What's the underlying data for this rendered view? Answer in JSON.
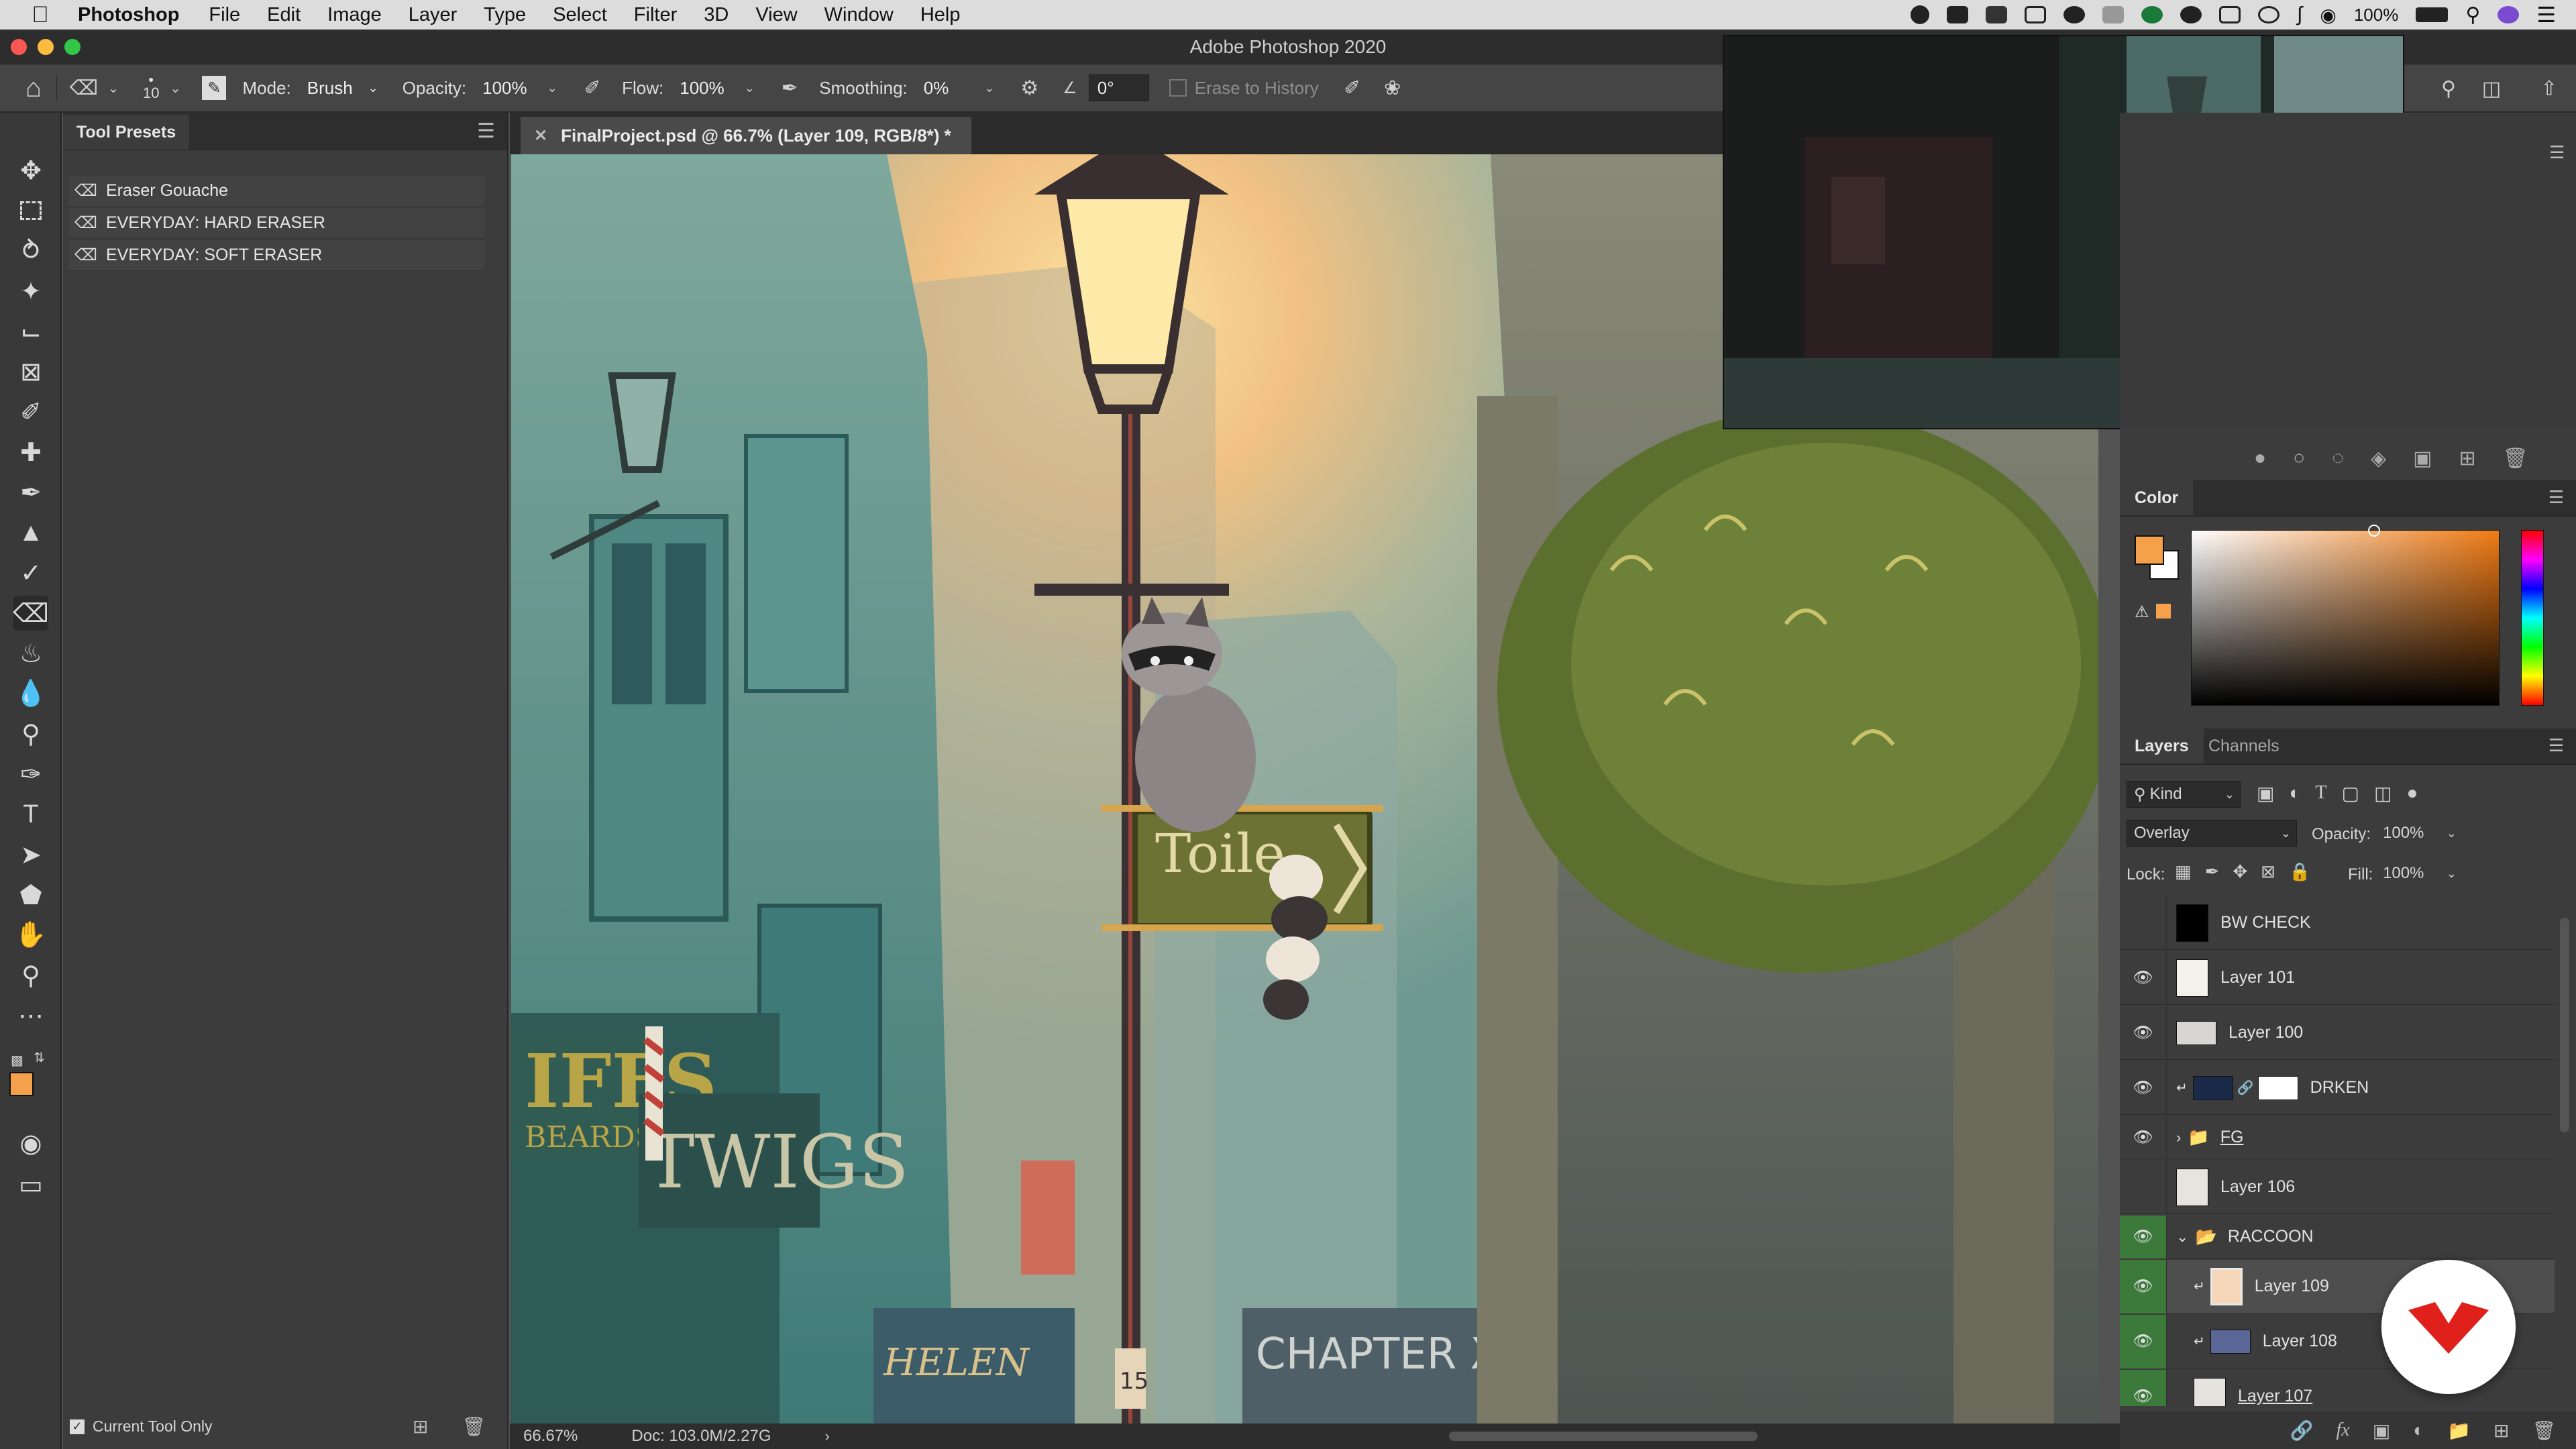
{
  "menubar": {
    "app": "Photoshop",
    "items": [
      "File",
      "Edit",
      "Image",
      "Layer",
      "Type",
      "Select",
      "Filter",
      "3D",
      "View",
      "Window",
      "Help"
    ],
    "battery": "100%"
  },
  "window": {
    "title": "Adobe Photoshop 2020"
  },
  "options": {
    "brush_size": "10",
    "mode_label": "Mode:",
    "mode_value": "Brush",
    "opacity_label": "Opacity:",
    "opacity_value": "100%",
    "flow_label": "Flow:",
    "flow_value": "100%",
    "smoothing_label": "Smoothing:",
    "smoothing_value": "0%",
    "angle_value": "0°",
    "erase_history": "Erase to History"
  },
  "presets_panel": {
    "tab": "Tool Presets",
    "items": [
      "Eraser Gouache",
      "EVERYDAY: HARD ERASER",
      "EVERYDAY: SOFT ERASER"
    ],
    "current_tool_only": "Current Tool Only"
  },
  "document": {
    "tab_label": "FinalProject.psd @ 66.7% (Layer 109, RGB/8*) *",
    "zoom": "66.67%",
    "doc_size": "Doc: 103.0M/2.27G"
  },
  "canvas_text": {
    "sign": "Toile",
    "shop1": "IFFS",
    "shop1b": "BEARDS",
    "shop2": "TWIGS",
    "shop3": "HELEN",
    "shop4": "CHAPTER XI",
    "pole_number": "15"
  },
  "color_panel": {
    "tab": "Color",
    "fg_color": "#f5a04a",
    "bg_color": "#ffffff"
  },
  "layers_panel": {
    "tabs": [
      "Layers",
      "Channels"
    ],
    "kind": "Kind",
    "blend": "Overlay",
    "opacity_label": "Opacity:",
    "opacity_value": "100%",
    "lock_label": "Lock:",
    "fill_label": "Fill:",
    "fill_value": "100%",
    "layers": [
      {
        "name": "BW CHECK",
        "visible": false
      },
      {
        "name": "Layer 101",
        "visible": true
      },
      {
        "name": "Layer 100",
        "visible": true
      },
      {
        "name": "DRKEN",
        "visible": true
      },
      {
        "name": "FG",
        "visible": true
      },
      {
        "name": "Layer 106",
        "visible": false
      },
      {
        "name": "RACCOON",
        "visible": true
      },
      {
        "name": "Layer 109",
        "visible": true
      },
      {
        "name": "Layer 108",
        "visible": true
      },
      {
        "name": "Layer 107",
        "visible": true
      }
    ]
  },
  "colors": {
    "accent_green": "#3b7a3b",
    "badge_red": "#e0201b"
  }
}
